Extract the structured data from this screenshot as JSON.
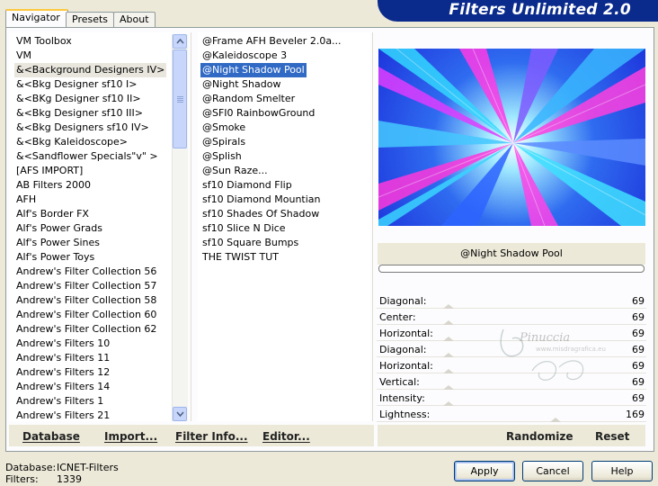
{
  "header": {
    "title": "Filters Unlimited 2.0"
  },
  "tabs": [
    {
      "label": "Navigator",
      "active": true
    },
    {
      "label": "Presets",
      "active": false
    },
    {
      "label": "About",
      "active": false
    }
  ],
  "categories": [
    "VM Toolbox",
    "VM",
    "&<Background Designers IV>",
    "&<Bkg Designer sf10 I>",
    "&<BKg Designer sf10 II>",
    "&<Bkg Designer sf10 III>",
    "&<Bkg Designers sf10 IV>",
    "&<Bkg Kaleidoscope>",
    "&<Sandflower Specials\"v\" >",
    "[AFS IMPORT]",
    "AB Filters 2000",
    "AFH",
    "Alf's Border FX",
    "Alf's Power Grads",
    "Alf's Power Sines",
    "Alf's Power Toys",
    "Andrew's Filter Collection 56",
    "Andrew's Filter Collection 57",
    "Andrew's Filter Collection 58",
    "Andrew's Filter Collection 60",
    "Andrew's Filter Collection 62",
    "Andrew's Filters 10",
    "Andrew's Filters 11",
    "Andrew's Filters 12",
    "Andrew's Filters 14",
    "Andrew's Filters 1",
    "Andrew's Filters 21"
  ],
  "selected_category_index": 2,
  "filters": [
    "@Frame AFH Beveler 2.0a...",
    "@Kaleidoscope 3",
    "@Night Shadow Pool",
    "@Night Shadow",
    "@Random Smelter",
    "@SFI0 RainbowGround",
    "@Smoke",
    "@Spirals",
    "@Splish",
    "@Sun Raze...",
    "sf10 Diamond Flip",
    "sf10 Diamond Mountian",
    "sf10 Shades Of Shadow",
    "sf10 Slice N Dice",
    "sf10 Square Bumps",
    "THE TWIST TUT"
  ],
  "selected_filter_index": 2,
  "preview": {
    "filter_name": "@Night Shadow Pool"
  },
  "params": [
    {
      "label": "Diagonal:",
      "value": "69"
    },
    {
      "label": "Center:",
      "value": "69"
    },
    {
      "label": "Horizontal:",
      "value": "69"
    },
    {
      "label": "Diagonal:",
      "value": "69"
    },
    {
      "label": "Horizontal:",
      "value": "69"
    },
    {
      "label": "Vertical:",
      "value": "69"
    },
    {
      "label": "Intensity:",
      "value": "69"
    },
    {
      "label": "Lightness:",
      "value": "169"
    }
  ],
  "left_buttons": {
    "database": "Database",
    "import": "Import...",
    "filter_info": "Filter Info...",
    "editor": "Editor..."
  },
  "right_buttons": {
    "randomize": "Randomize",
    "reset": "Reset"
  },
  "status": {
    "database_label": "Database:",
    "database_value": "ICNET-Filters",
    "filters_label": "Filters:",
    "filters_value": "1339"
  },
  "dialog_buttons": {
    "apply": "Apply",
    "cancel": "Cancel",
    "help": "Help"
  },
  "watermark": {
    "name": "Pinuccia",
    "url": "www.misdragrafica.eu"
  },
  "icons": [
    "scroll-up-icon",
    "scroll-down-icon",
    "scroll-grip-icon"
  ],
  "colors": {
    "banner": "#0a2a8c",
    "selection": "#316ac5",
    "window": "#ece9d8"
  }
}
